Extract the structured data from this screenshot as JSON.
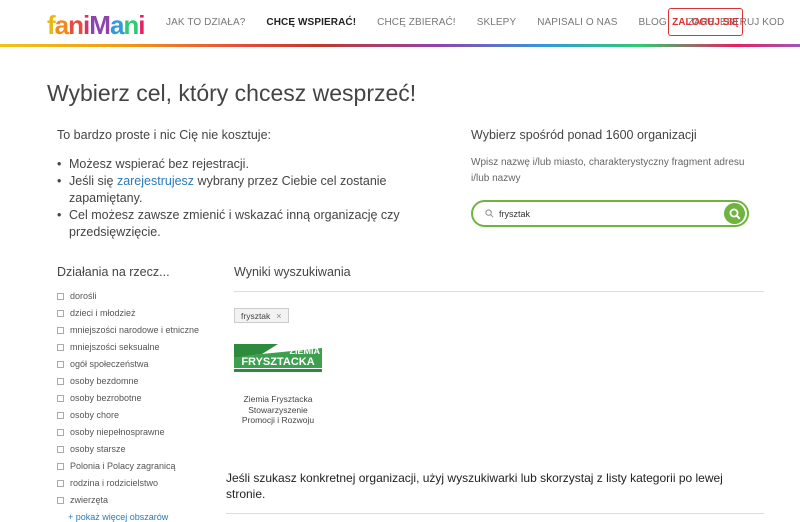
{
  "logo": {
    "text": "faniMani"
  },
  "nav": {
    "items": [
      {
        "label": "JAK TO DZIAŁA?"
      },
      {
        "label": "CHCĘ WSPIERAĆ!"
      },
      {
        "label": "CHCĘ ZBIERAĆ!"
      },
      {
        "label": "SKLEPY"
      },
      {
        "label": "NAPISALI O NAS"
      },
      {
        "label": "BLOG"
      },
      {
        "label": "ZAREJESTRUJ KOD"
      }
    ],
    "login_label": "ZALOGUJ SIĘ"
  },
  "page_title": "Wybierz cel, który chcesz wesprzeć!",
  "intro": {
    "lead": "To bardzo proste i nic Cię nie kosztuje:",
    "bullet1": "Możesz wspierać bez rejestracji.",
    "bullet2_pre": "Jeśli się ",
    "bullet2_link": "zarejestrujesz",
    "bullet2_post": " wybrany przez Ciebie cel zostanie zapamiętany.",
    "bullet3": "Cel możesz zawsze zmienić i wskazać inną organizację czy przedsięwzięcie."
  },
  "search": {
    "title": "Wybierz spośród ponad 1600 organizacji",
    "hint": "Wpisz nazwę i/lub miasto, charakterystyczny fragment adresu i/lub nazwy",
    "value": "frysztak"
  },
  "sidebar": {
    "title": "Działania na rzecz...",
    "categories": [
      "dorośli",
      "dzieci i młodzież",
      "mniejszości narodowe i etniczne",
      "mniejszości seksualne",
      "ogół społeczeństwa",
      "osoby bezdomne",
      "osoby bezrobotne",
      "osoby chore",
      "osoby niepełnosprawne",
      "osoby starsze",
      "Polonia i Polacy zagranicą",
      "rodzina i rodzicielstwo",
      "zwierzęta"
    ],
    "more_label": "+ pokaż więcej obszarów"
  },
  "results": {
    "title": "Wyniki wyszukiwania",
    "tag": "frysztak",
    "org": {
      "logo_text_top": "ZIEMIA",
      "logo_text_bottom": "FRYSZTACKA",
      "name": "Ziemia Frysztacka Stowarzyszenie Promocji i Rozwoju"
    },
    "note": "Jeśli szukasz konkretnej organizacji, użyj wyszukiwarki lub skorzystaj z listy kategorii po lewej stronie."
  },
  "colors": {
    "accent_green": "#6fb43f",
    "login_red": "#dd3333",
    "link_blue": "#2a7ab8"
  }
}
